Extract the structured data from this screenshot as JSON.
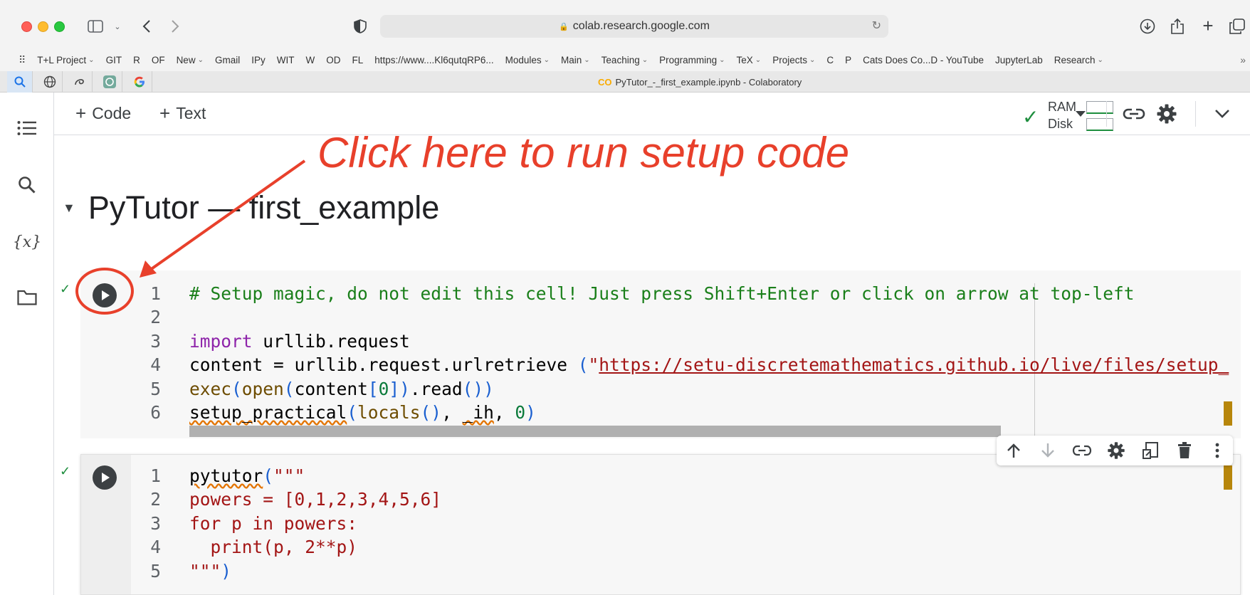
{
  "browser": {
    "url": "colab.research.google.com",
    "bookmarks": [
      {
        "label": "T+L Project",
        "dropdown": true
      },
      {
        "label": "GIT",
        "dropdown": false
      },
      {
        "label": "R",
        "dropdown": false
      },
      {
        "label": "OF",
        "dropdown": false
      },
      {
        "label": "New",
        "dropdown": true
      },
      {
        "label": "Gmail",
        "dropdown": false
      },
      {
        "label": "IPy",
        "dropdown": false
      },
      {
        "label": "WIT",
        "dropdown": false
      },
      {
        "label": "W",
        "dropdown": false
      },
      {
        "label": "OD",
        "dropdown": false
      },
      {
        "label": "FL",
        "dropdown": false
      },
      {
        "label": "https://www....Kl6qutqRP6...",
        "dropdown": false
      },
      {
        "label": "Modules",
        "dropdown": true
      },
      {
        "label": "Main",
        "dropdown": true
      },
      {
        "label": "Teaching",
        "dropdown": true
      },
      {
        "label": "Programming",
        "dropdown": true
      },
      {
        "label": "TeX",
        "dropdown": true
      },
      {
        "label": "Projects",
        "dropdown": true
      },
      {
        "label": "C",
        "dropdown": false
      },
      {
        "label": "P",
        "dropdown": false
      },
      {
        "label": "Cats Does Co...D - YouTube",
        "dropdown": false
      },
      {
        "label": "JupyterLab",
        "dropdown": false
      },
      {
        "label": "Research",
        "dropdown": true
      }
    ],
    "tab_title": "PyTutor_-_first_example.ipynb - Colaboratory",
    "tab_logo": "CO"
  },
  "toolbar": {
    "code_label": "Code",
    "text_label": "Text",
    "ram_label": "RAM",
    "disk_label": "Disk"
  },
  "notebook": {
    "heading": "PyTutor — first_example",
    "annotation": "Click here to run setup code"
  },
  "cell1": {
    "line_numbers": [
      "1",
      "2",
      "3",
      "4",
      "5",
      "6"
    ],
    "lines": [
      [
        {
          "t": "# Setup magic, do not edit this cell! Just press Shift+Enter or click on arrow at top-left",
          "c": "c-comment"
        }
      ],
      [],
      [
        {
          "t": "import",
          "c": "c-kw"
        },
        {
          "t": " urllib.request",
          "c": ""
        }
      ],
      [
        {
          "t": "content = urllib.request.urlretrieve ",
          "c": ""
        },
        {
          "t": "(",
          "c": "c-paren"
        },
        {
          "t": "\"",
          "c": "c-str"
        },
        {
          "t": "https://setu-discretemathematics.github.io/live/files/setup_",
          "c": "c-url"
        }
      ],
      [
        {
          "t": "exec",
          "c": "c-fn"
        },
        {
          "t": "(",
          "c": "c-paren"
        },
        {
          "t": "open",
          "c": "c-fn"
        },
        {
          "t": "(",
          "c": "c-paren"
        },
        {
          "t": "content",
          "c": ""
        },
        {
          "t": "[",
          "c": "c-paren"
        },
        {
          "t": "0",
          "c": "c-num"
        },
        {
          "t": "]",
          "c": "c-paren"
        },
        {
          "t": ")",
          "c": "c-paren"
        },
        {
          "t": ".read",
          "c": ""
        },
        {
          "t": "()",
          "c": "c-paren"
        },
        {
          "t": ")",
          "c": "c-paren"
        }
      ],
      [
        {
          "t": "setup_practical",
          "c": "squiggle"
        },
        {
          "t": "(",
          "c": "c-paren"
        },
        {
          "t": "locals",
          "c": "c-fn"
        },
        {
          "t": "()",
          "c": "c-paren"
        },
        {
          "t": ", ",
          "c": ""
        },
        {
          "t": "_ih",
          "c": "squiggle"
        },
        {
          "t": ", ",
          "c": ""
        },
        {
          "t": "0",
          "c": "c-num"
        },
        {
          "t": ")",
          "c": "c-paren"
        }
      ]
    ]
  },
  "cell2": {
    "line_numbers": [
      "1",
      "2",
      "3",
      "4",
      "5"
    ],
    "lines": [
      [
        {
          "t": "pytutor",
          "c": "squiggle"
        },
        {
          "t": "(",
          "c": "c-paren"
        },
        {
          "t": "\"\"\"",
          "c": "c-str"
        }
      ],
      [
        {
          "t": "powers = [0,1,2,3,4,5,6]",
          "c": "c-str"
        }
      ],
      [
        {
          "t": "for p in powers:",
          "c": "c-str"
        }
      ],
      [
        {
          "t": "  print(p, 2**p)",
          "c": "c-str"
        }
      ],
      [
        {
          "t": "\"\"\"",
          "c": "c-str"
        },
        {
          "t": ")",
          "c": "c-paren"
        }
      ]
    ]
  },
  "colors": {
    "annotation": "#e8402b",
    "run_button": "#3c4043",
    "success": "#1e8e3e"
  }
}
